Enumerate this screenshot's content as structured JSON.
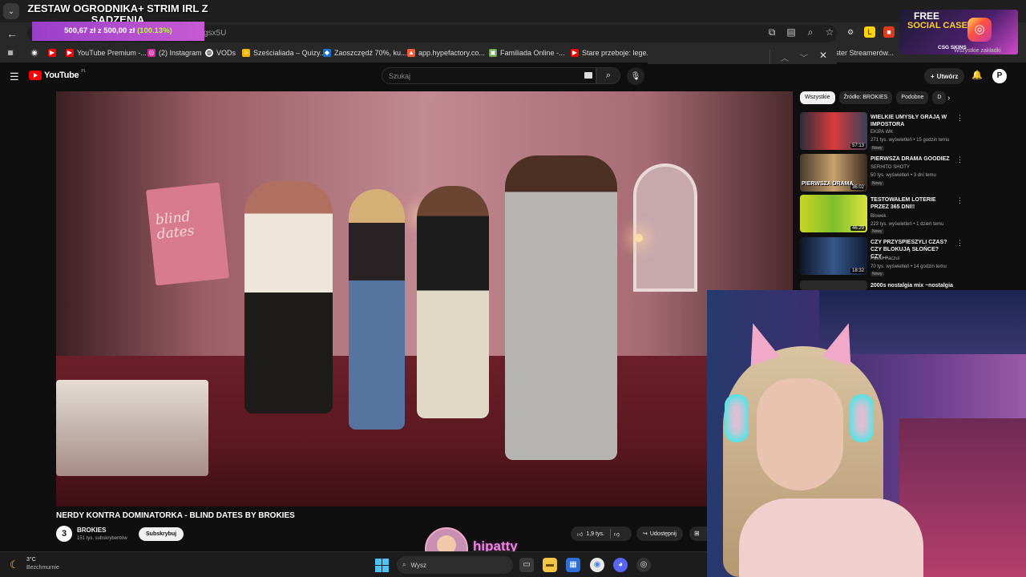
{
  "overlay": {
    "title": "ZESTAW OGRODNIKA+ STRIM IRL Z SADZENIA",
    "goal_current": "500,67 zł",
    "goal_sep": "z",
    "goal_target": "500,00 zł",
    "goal_pct": "(100.13%)",
    "promo_line1": "FREE",
    "promo_line2": "SOCIAL CASES",
    "promo_brand": "CSG SKINS",
    "donor_name": "hipatty"
  },
  "browser": {
    "url_fragment": "gsx5U",
    "right_bookmark_text": "Wszystkie zakładki",
    "bookmarks": [
      {
        "label": "YouTube Premium -...",
        "color": "#ff0000"
      },
      {
        "label": "(2) Instagram",
        "color": "#d6249f"
      },
      {
        "label": "VODs",
        "color": "#ffffff"
      },
      {
        "label": "Sześcialiada – Quizy...",
        "color": "#f4b400"
      },
      {
        "label": "Zaoszczędź 70%, ku...",
        "color": "#1b6fd1"
      },
      {
        "label": "app.hypefactory.co...",
        "color": "#ff5a36"
      },
      {
        "label": "Familiada Online -...",
        "color": "#6aa84f"
      },
      {
        "label": "Stare przeboje: lege...",
        "color": "#ff0000"
      },
      {
        "label": "ster Streamerów...",
        "color": "#888888"
      }
    ]
  },
  "youtube": {
    "logo_text": "YouTube",
    "region": "PL",
    "search_placeholder": "Szukaj",
    "create_label": "Utwórz",
    "user_initial": "P",
    "video": {
      "title": "NERDY KONTRA DOMINATORKA - BLIND DATES BY BROKIES",
      "channel_initial": "3",
      "channel": "BROKIES",
      "subscribers": "151 tys. subskrybentów",
      "subscribe_label": "Subskrybuj",
      "likes": "1,9 tys.",
      "share_label": "Udostępnij",
      "sign_text": "blind dates"
    },
    "chips": [
      "Wszystkie",
      "Źródło: BROKIES",
      "Podobne",
      "D"
    ],
    "recommendations": [
      {
        "title": "WIELKIE UMYSŁY GRAJĄ W IMPOSTORA",
        "channel": "EKIPA WK",
        "meta": "271 tys. wyświetleń • 15 godzin temu",
        "badge": "Nowy",
        "duration": "57:13"
      },
      {
        "title": "PIERWSZA DRAMA GOODIEZ",
        "channel": "SERHITO SHOTY",
        "meta": "50 tys. wyświetleń • 3 dni temu",
        "badge": "Nowy",
        "duration": "36:02",
        "thumb_text": "PIERWSZA DRAMA"
      },
      {
        "title": "TESTOWAŁEM LOTERIE PRZEZ 365 DNI!!",
        "channel": "Blowek",
        "meta": "223 tys. wyświetleń • 1 dzień temu",
        "badge": "Nowy",
        "duration": "46:29"
      },
      {
        "title": "CZY PRZYSPIESZYLI CZAS? CZY BLOKUJĄ SŁOŃCE? CZY ...",
        "channel": "Paweł Paczul",
        "meta": "70 tys. wyświetleń • 14 godzin temu",
        "badge": "Nowy",
        "duration": "18:32"
      },
      {
        "title": "2000s nostalgia mix ~nostalgia",
        "channel": "",
        "meta": "",
        "badge": "",
        "duration": ""
      }
    ]
  },
  "taskbar": {
    "temp": "3°C",
    "weather": "Bezchmurnie",
    "search_text": "Wysz"
  }
}
